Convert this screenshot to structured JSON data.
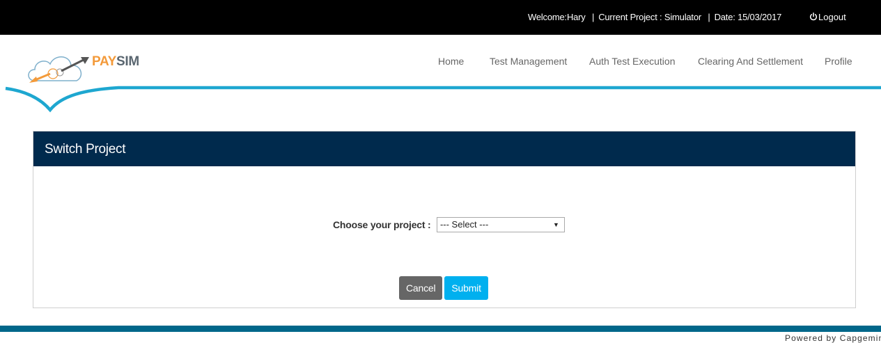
{
  "topbar": {
    "welcome": "Welcome:Hary",
    "project": "Current Project : Simulator",
    "date": "Date: 15/03/2017",
    "separator": "|",
    "logout": "Logout"
  },
  "logo": {
    "brand_pay": "PAY",
    "brand_sim": "SIM"
  },
  "nav": {
    "items": [
      {
        "label": "Home"
      },
      {
        "label": "Test Management"
      },
      {
        "label": "Auth Test Execution"
      },
      {
        "label": "Clearing And Settlement"
      },
      {
        "label": "Profile"
      }
    ]
  },
  "panel": {
    "title": "Switch Project",
    "choose_label": "Choose your project :",
    "select_value": "--- Select ---",
    "cancel_label": "Cancel",
    "submit_label": "Submit"
  },
  "footer": {
    "text": "Powered by Capgemini"
  },
  "colors": {
    "topbar_bg": "#000000",
    "panel_header_bg": "#002a4d",
    "swoosh": "#1ea7d0",
    "submit_bg": "#00b0ef",
    "cancel_bg": "#666666",
    "footer_bar": "#00678a",
    "brand_orange": "#f39a3a"
  },
  "icons": {
    "logout": "power-icon",
    "select": "caret-down-icon",
    "logo": "cloud-logo-icon"
  }
}
